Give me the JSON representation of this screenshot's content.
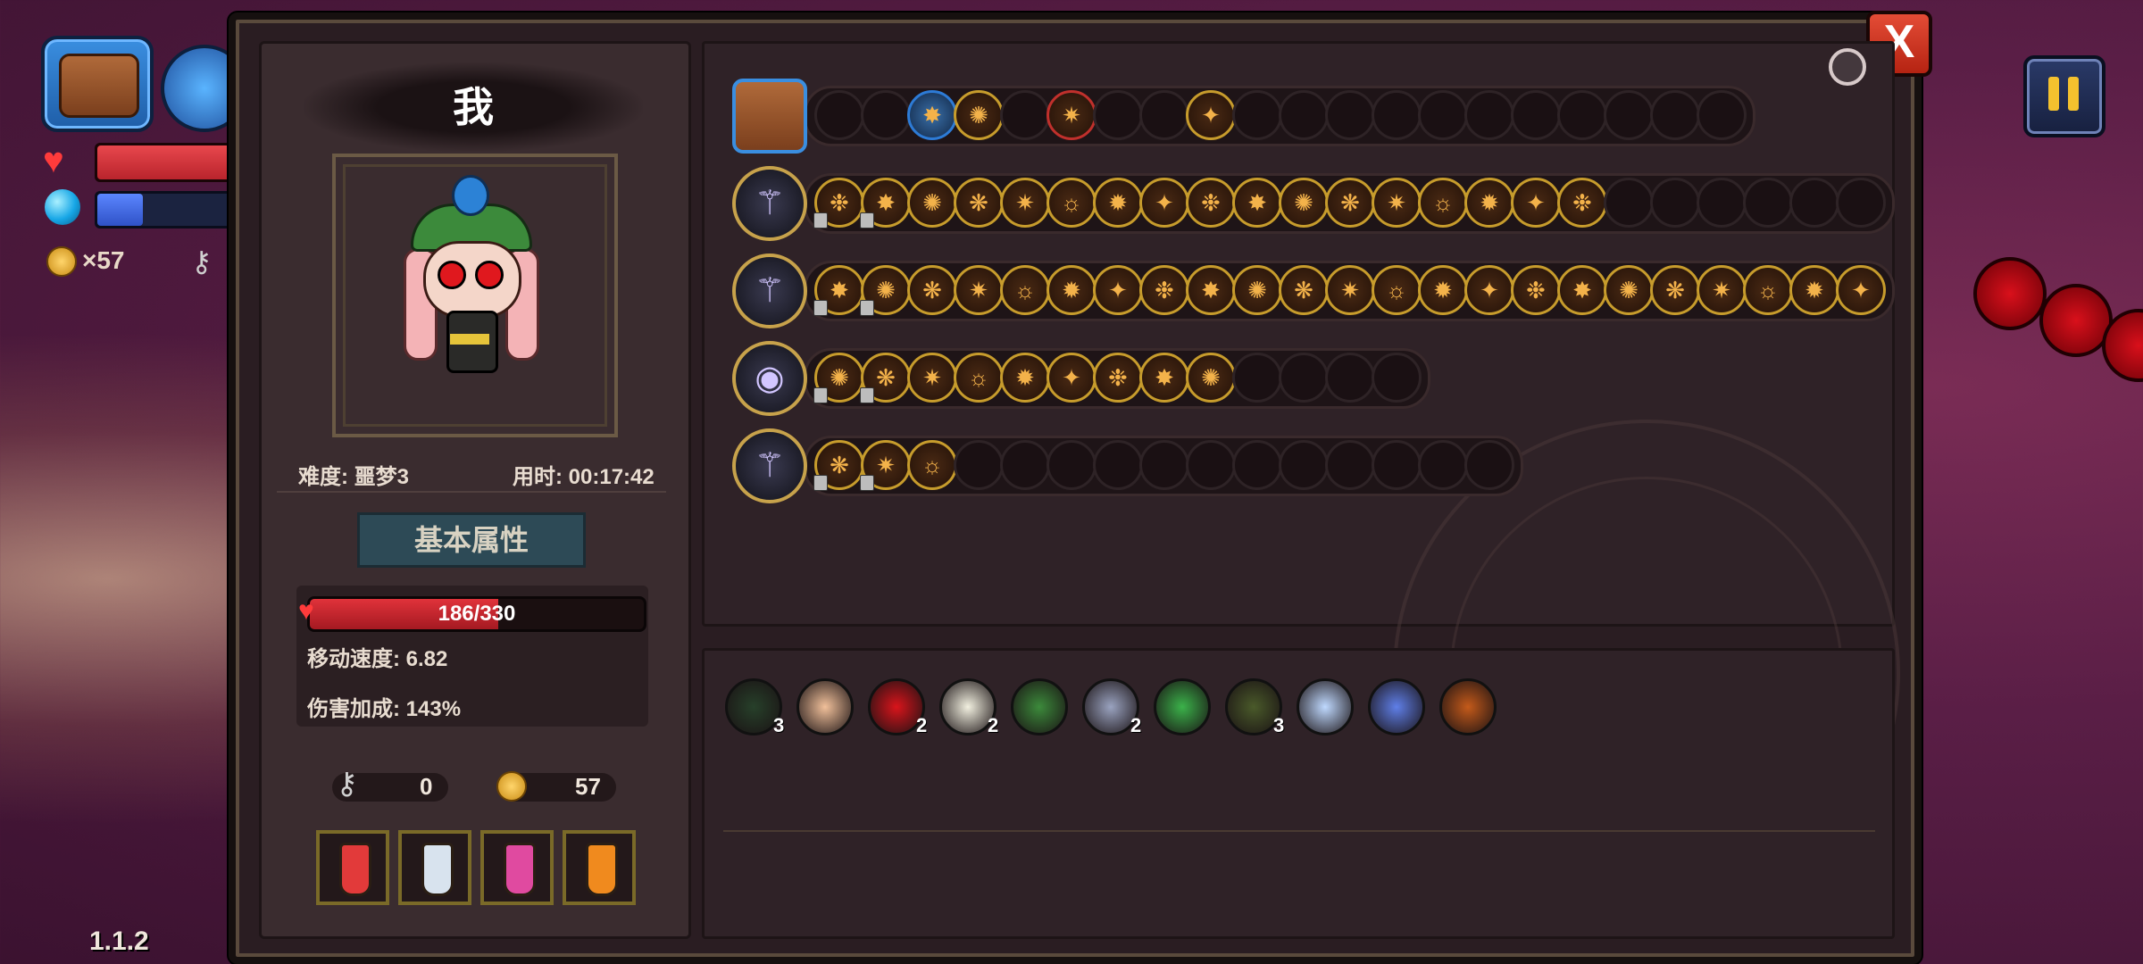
{
  "hud": {
    "coin_count": "×57",
    "version": "1.1.2",
    "hp_fill": 1.0,
    "mp_fill": 0.32
  },
  "panel": {
    "close_label": "X",
    "player_name": "我",
    "difficulty": "难度: 噩梦3",
    "time": "用时: 00:17:42",
    "tab_basic": "基本属性",
    "hp_text": "186/330",
    "hp_current": 186,
    "hp_max": 330,
    "move_speed": "移动速度: 6.82",
    "damage_bonus": "伤害加成: 143%",
    "keys": "0",
    "gold": "57"
  },
  "potions": [
    {
      "name": "red-vial",
      "color": "#e23a3a"
    },
    {
      "name": "empty-flask",
      "color": "#d8e3ee"
    },
    {
      "name": "pink-flask",
      "color": "#e04aa0"
    },
    {
      "name": "orange-flask",
      "color": "#f08a1e"
    }
  ],
  "weapon_rows": [
    {
      "icon": "bag-icon",
      "slots": 20,
      "filled": 5
    },
    {
      "icon": "staff-icon",
      "slots": 23,
      "filled": 17
    },
    {
      "icon": "staff-icon",
      "slots": 23,
      "filled": 23
    },
    {
      "icon": "orb-icon",
      "slots": 13,
      "filled": 9
    },
    {
      "icon": "mallet-icon",
      "slots": 15,
      "filled": 3
    }
  ],
  "items": [
    {
      "name": "cloak-item",
      "count": "3",
      "color": "#27402a"
    },
    {
      "name": "ear-item",
      "count": "",
      "color": "#f1c09a"
    },
    {
      "name": "red-eye-item",
      "count": "2",
      "color": "#d9141b"
    },
    {
      "name": "teeth-item",
      "count": "2",
      "color": "#f2f0e0"
    },
    {
      "name": "helmet-item",
      "count": "",
      "color": "#3c8a3b"
    },
    {
      "name": "stone-item",
      "count": "2",
      "color": "#9aa3c0"
    },
    {
      "name": "leaf-item",
      "count": "",
      "color": "#3bb24a"
    },
    {
      "name": "worm-item",
      "count": "3",
      "color": "#4a5a2a"
    },
    {
      "name": "crystal-item",
      "count": "",
      "color": "#bfd9ff"
    },
    {
      "name": "flower-item",
      "count": "",
      "color": "#5f7fe8"
    },
    {
      "name": "crate-item",
      "count": "",
      "color": "#c45a1a"
    }
  ]
}
